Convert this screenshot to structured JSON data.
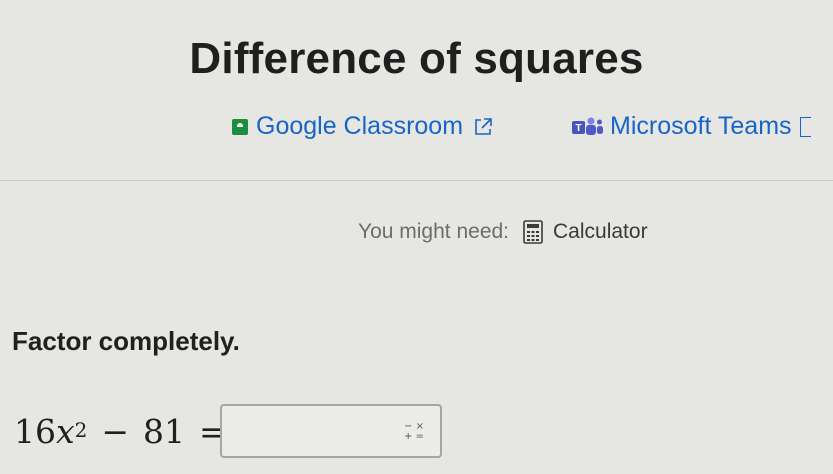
{
  "header": {
    "title": "Difference of squares"
  },
  "share": {
    "google_classroom_label": "Google Classroom",
    "microsoft_teams_label": "Microsoft Teams"
  },
  "tools": {
    "need_label": "You might need:",
    "calculator_label": "Calculator"
  },
  "question": {
    "prompt": "Factor completely.",
    "coefficient": "16",
    "variable": "x",
    "exponent": "2",
    "operator": "−",
    "constant": "81",
    "equals": "=",
    "answer_value": ""
  },
  "math_keys": {
    "top": "− ×",
    "bottom": "+ ="
  },
  "colors": {
    "link": "#1865c9",
    "classroom_green": "#1e8e3e",
    "teams_purple": "#4b53bc"
  },
  "icons": [
    "google-classroom-icon",
    "external-link-icon",
    "microsoft-teams-icon",
    "calculator-icon",
    "math-keypad-icon"
  ]
}
